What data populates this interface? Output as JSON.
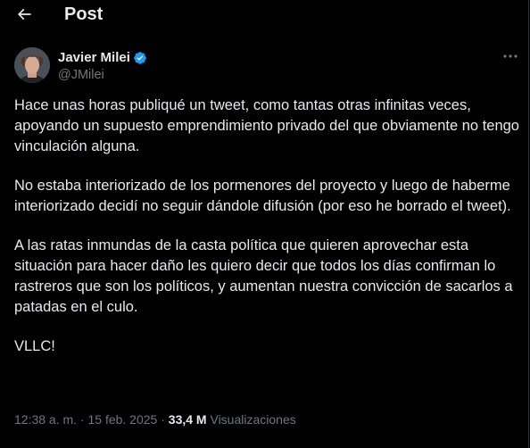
{
  "header": {
    "title": "Post",
    "back_icon": "arrow-left-icon"
  },
  "author": {
    "display_name": "Javier Milei",
    "handle": "@JMilei",
    "verified_icon": "verified-badge-icon",
    "verified_color": "#1d9bf0"
  },
  "post": {
    "paragraphs": [
      "Hace unas horas publiqué un tweet, como tantas otras infinitas veces, apoyando un supuesto emprendimiento privado del que obviamente no tengo vinculación alguna.",
      "No estaba interiorizado de los pormenores del proyecto y luego de haberme interiorizado decidí no seguir dándole difusión (por eso he borrado el tweet).",
      "A las ratas inmundas de la casta política que quieren aprovechar esta situación para hacer daño les quiero decir que todos los días confirman lo rastreros que son los políticos, y aumentan nuestra convicción de sacarlos a patadas en el culo.",
      "VLLC!"
    ],
    "timestamp": "12:38 a. m. · 15 feb. 2025 · ",
    "views_count": "33,4 M",
    "views_label": " Visualizaciones"
  },
  "colors": {
    "background": "#000000",
    "text": "#e7e9ea",
    "secondary_text": "#71767b",
    "divider": "#2f3336"
  }
}
